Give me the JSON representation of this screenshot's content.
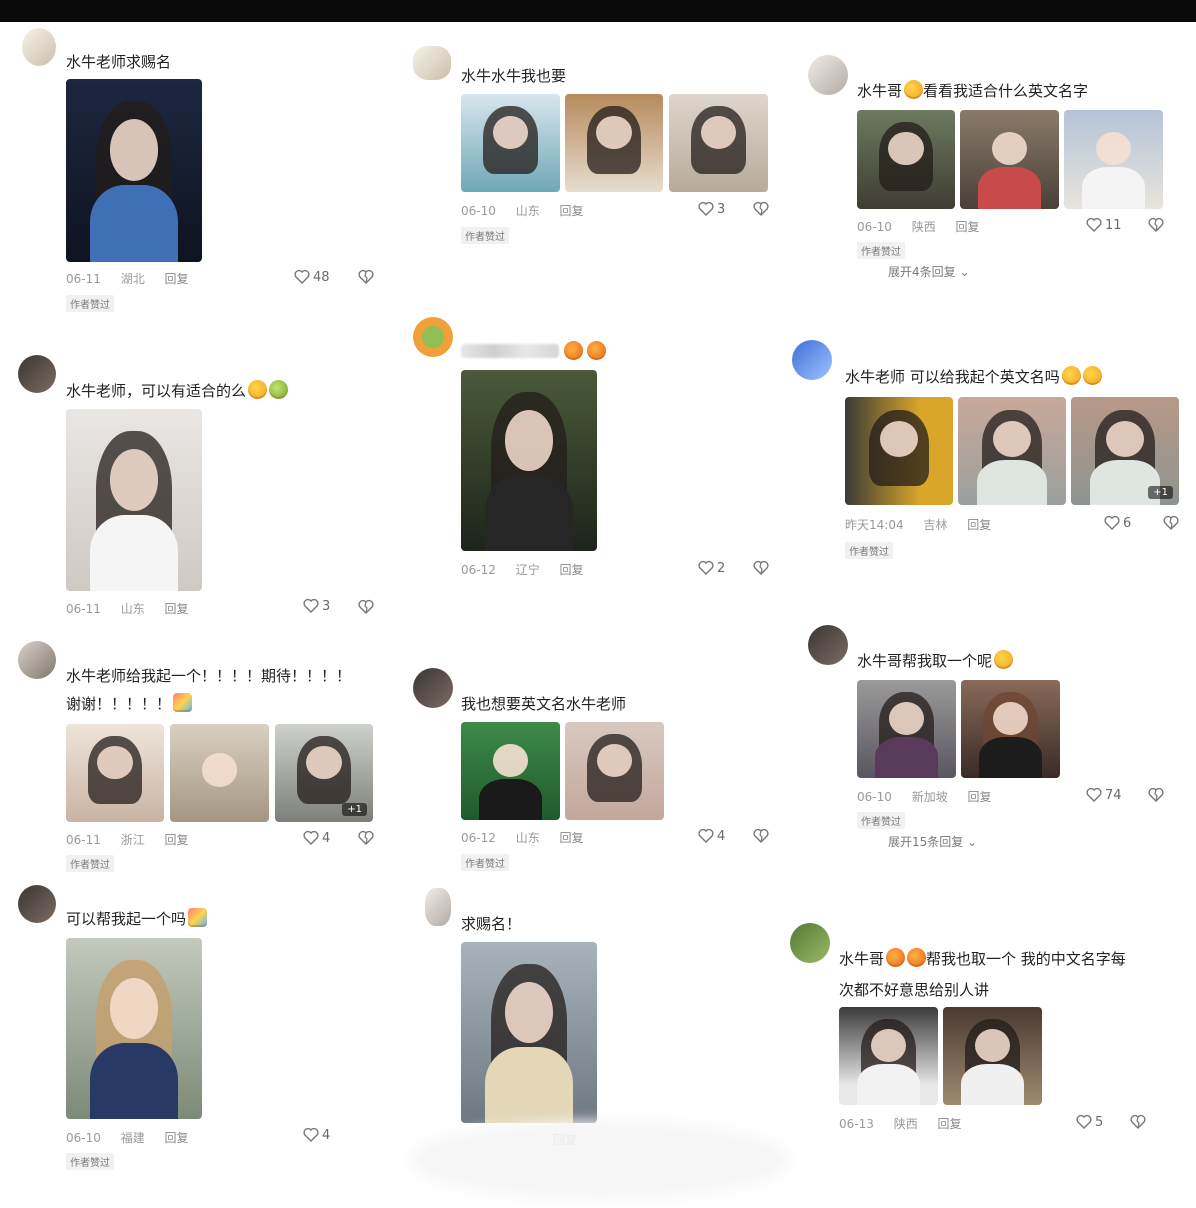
{
  "ui": {
    "like_icon": "heart-outline-icon",
    "dislike_icon": "broken-heart-icon",
    "reply_label": "回复",
    "author_tag": "作者赞过"
  },
  "col1": [
    {
      "comment": "水牛老师求赐名",
      "date": "06-11",
      "location": "湖北",
      "likes": "48"
    },
    {
      "comment": "水牛老师，可以有适合的么",
      "date": "06-11",
      "location": "山东",
      "likes": "3"
    },
    {
      "comment_line1": "水牛老师给我起一个！！！！期待！！！！",
      "comment_line2": "谢谢！！！！！",
      "more_photos": "+1",
      "date": "06-11",
      "location": "浙江",
      "likes": "4"
    },
    {
      "comment": "可以帮我起一个吗",
      "date": "06-10",
      "location": "福建",
      "likes": "4"
    }
  ],
  "col2": [
    {
      "comment": "水牛水牛我也要",
      "date": "06-10",
      "location": "山东",
      "likes": "3"
    },
    {
      "date": "06-12",
      "location": "辽宁",
      "likes": "2"
    },
    {
      "comment": "我也想要英文名水牛老师",
      "date": "06-12",
      "location": "山东",
      "likes": "4"
    },
    {
      "comment": "求赐名！"
    }
  ],
  "col3": [
    {
      "comment_a": "水牛哥",
      "comment_b": "看看我适合什么英文名字",
      "date": "06-10",
      "location": "陕西",
      "likes": "11",
      "expand": "展开4条回复"
    },
    {
      "comment": "水牛老师 可以给我起个英文名吗",
      "more_photos": "+1",
      "date": "昨天14:04",
      "location": "吉林",
      "likes": "6"
    },
    {
      "comment": "水牛哥帮我取一个呢",
      "date": "06-10",
      "location": "新加坡",
      "likes": "74",
      "expand": "展开15条回复"
    },
    {
      "comment_a": "水牛哥",
      "comment_b": "帮我也取一个  我的中文名字每",
      "comment_line2": "次都不好意思给别人讲",
      "date": "06-13",
      "location": "陕西",
      "likes": "5"
    }
  ]
}
